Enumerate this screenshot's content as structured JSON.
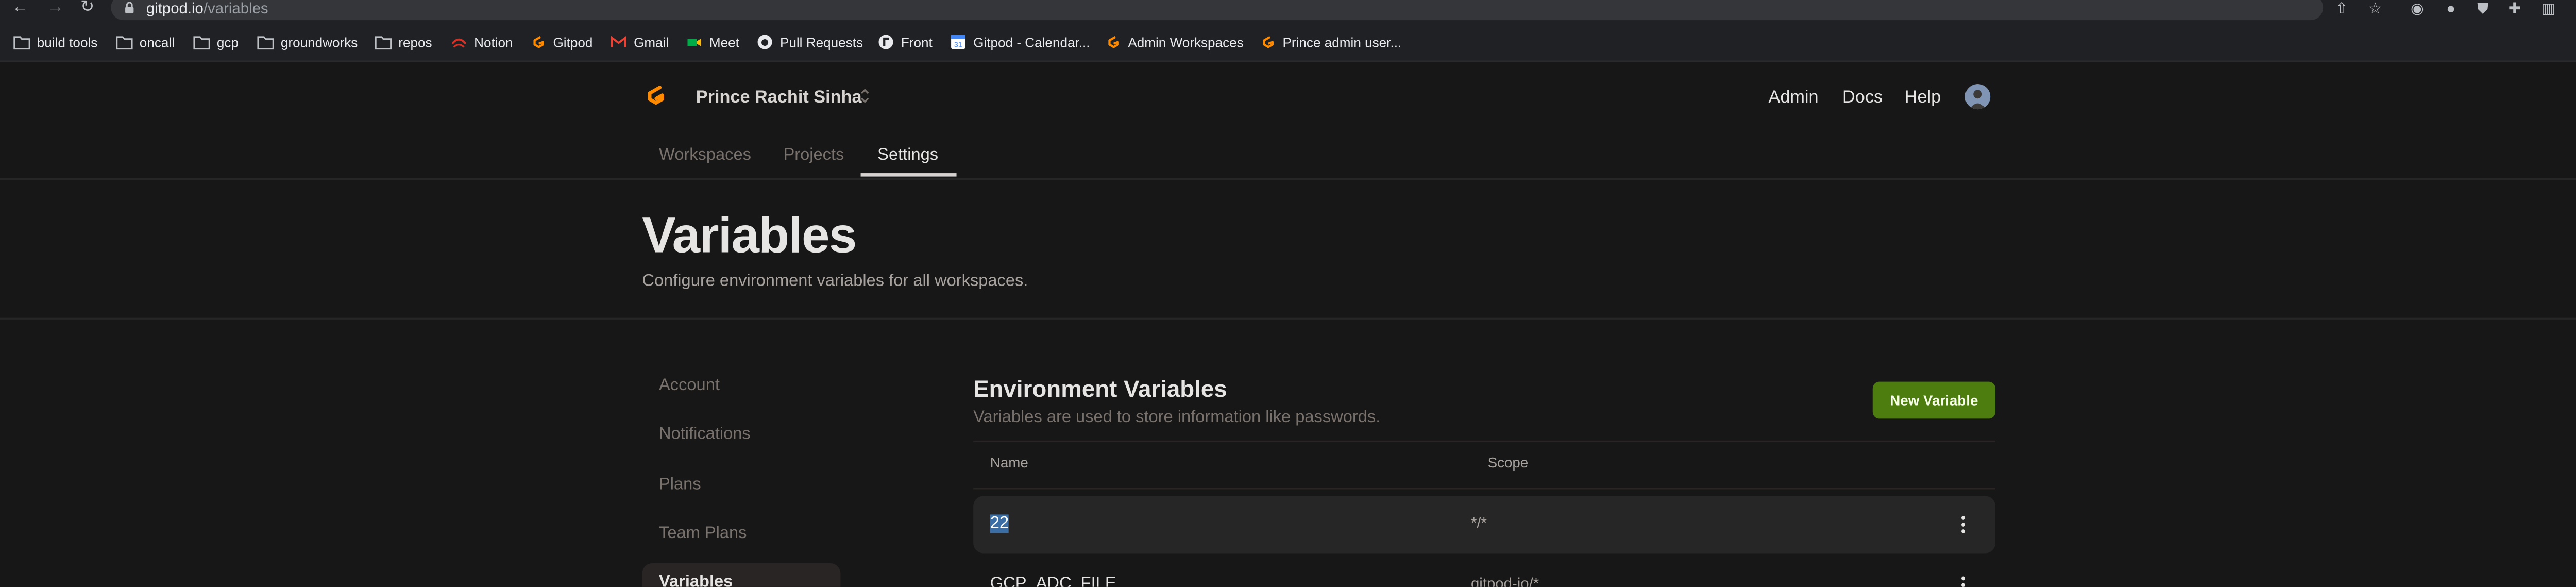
{
  "browser": {
    "url_host": "gitpod.io",
    "url_path": "/variables",
    "bookmarks": [
      {
        "label": "build tools",
        "icon": "folder-icon"
      },
      {
        "label": "oncall",
        "icon": "folder-icon"
      },
      {
        "label": "gcp",
        "icon": "folder-icon"
      },
      {
        "label": "groundworks",
        "icon": "folder-icon"
      },
      {
        "label": "repos",
        "icon": "folder-icon"
      },
      {
        "label": "Notion",
        "icon": "notion-icon"
      },
      {
        "label": "Gitpod",
        "icon": "gitpod-icon"
      },
      {
        "label": "Gmail",
        "icon": "gmail-icon"
      },
      {
        "label": "Meet",
        "icon": "meet-icon"
      },
      {
        "label": "Pull Requests",
        "icon": "github-icon"
      },
      {
        "label": "Front",
        "icon": "front-icon"
      },
      {
        "label": "Gitpod - Calendar...",
        "icon": "calendar-icon"
      },
      {
        "label": "Admin Workspaces",
        "icon": "gitpod-icon"
      },
      {
        "label": "Prince admin user...",
        "icon": "gitpod-icon"
      }
    ]
  },
  "header": {
    "team_name": "Prince Rachit Sinha",
    "links": [
      "Admin",
      "Docs",
      "Help"
    ],
    "tabs": [
      {
        "label": "Workspaces",
        "active": false
      },
      {
        "label": "Projects",
        "active": false
      },
      {
        "label": "Settings",
        "active": true
      }
    ]
  },
  "page": {
    "title": "Variables",
    "subtitle": "Configure environment variables for all workspaces."
  },
  "menu": {
    "items": [
      {
        "label": "Account",
        "active": false
      },
      {
        "label": "Notifications",
        "active": false
      },
      {
        "label": "Plans",
        "active": false
      },
      {
        "label": "Team Plans",
        "active": false
      },
      {
        "label": "Variables",
        "active": true
      }
    ]
  },
  "content": {
    "title": "Environment Variables",
    "subtitle": "Variables are used to store information like passwords.",
    "new_button": "New Variable",
    "columns": [
      "Name",
      "Scope"
    ],
    "rows": [
      {
        "name": "22",
        "scope": "*/*"
      },
      {
        "name": "GCP_ADC_FILE",
        "scope": "gitpod-io/*"
      }
    ]
  },
  "colors": {
    "background": "#171717",
    "accent_button": "#4d7c0f",
    "gitpod_orange": "#ff8a00"
  }
}
